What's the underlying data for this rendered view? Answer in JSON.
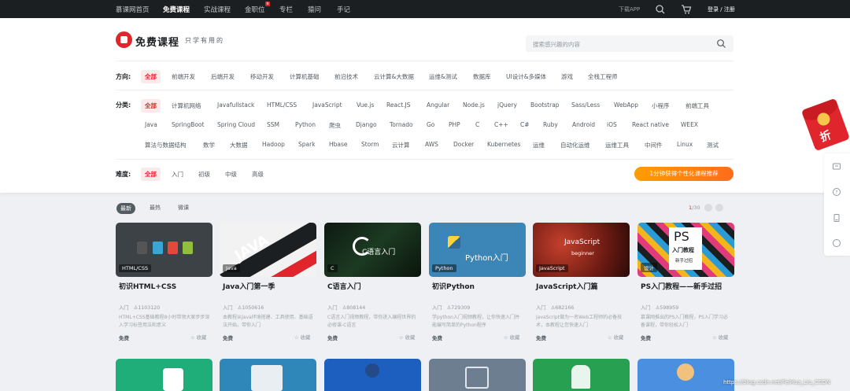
{
  "topnav": {
    "items": [
      "慕课网首页",
      "免费课程",
      "实战课程",
      "金职位",
      "专栏",
      "猿问",
      "手记"
    ],
    "badge": "N",
    "app": "下载APP",
    "login": "登录 / 注册"
  },
  "header": {
    "title": "免费课程",
    "subtitle": "只学有用的",
    "search_placeholder": "搜索感兴趣的内容"
  },
  "filters": {
    "direction_label": "方向:",
    "direction": [
      "全部",
      "前端开发",
      "后端开发",
      "移动开发",
      "计算机基础",
      "前沿技术",
      "云计算&大数据",
      "运维&测试",
      "数据库",
      "UI设计&多媒体",
      "游戏",
      "全栈工程师"
    ],
    "category_label": "分类:",
    "category_row1": [
      "全部",
      "计算机网络",
      "Javafullstack",
      "HTML/CSS",
      "JavaScript",
      "Vue.js",
      "React.JS",
      "Angular",
      "Node.js",
      "jQuery",
      "Bootstrap",
      "Sass/Less",
      "WebApp",
      "小程序",
      "前端工具"
    ],
    "category_row2": [
      "Java",
      "SpringBoot",
      "Spring Cloud",
      "SSM",
      "Python",
      "爬虫",
      "Django",
      "Tornado",
      "Go",
      "PHP",
      "C",
      "C++",
      "C#",
      "Ruby",
      "Android",
      "iOS",
      "React native",
      "WEEX"
    ],
    "category_row3": [
      "算法与数据结构",
      "数学",
      "大数据",
      "Hadoop",
      "Spark",
      "Hbase",
      "Storm",
      "云计算",
      "AWS",
      "Docker",
      "Kubernetes",
      "运维",
      "自动化运维",
      "运维工具",
      "中间件",
      "Linux",
      "测试"
    ],
    "difficulty_label": "难度:",
    "difficulty": [
      "全部",
      "入门",
      "初级",
      "中级",
      "高级"
    ],
    "recommend": "1分钟获得个性化课程推荐"
  },
  "sort": {
    "options": [
      "最新",
      "最热",
      "微课"
    ],
    "page_current": "1",
    "page_total": "/30"
  },
  "courses": [
    {
      "category": "HTML/CSS",
      "title": "初识HTML+CSS",
      "level": "入门",
      "learners": "1103120",
      "desc": "HTML+CSS基础教程8小时带领大家步步深入学习标签用法和意义",
      "price": "免费",
      "fav": "收藏",
      "art": ""
    },
    {
      "category": "Java",
      "title": "Java入门第一季",
      "level": "入门",
      "learners": "1050616",
      "desc": "本教程从Java环境搭建、工具使用、基础语法开始，带你入门",
      "price": "免费",
      "fav": "收藏",
      "art": "JAVA"
    },
    {
      "category": "C",
      "title": "C语言入门",
      "level": "入门",
      "learners": "808144",
      "desc": "C语言入门视频教程，带你进入编程世界的必修课-C语言",
      "price": "免费",
      "fav": "收藏",
      "art": "C语言入门"
    },
    {
      "category": "Python",
      "title": "初识Python",
      "level": "入门",
      "learners": "729309",
      "desc": "学python入门视频教程，让你快速入门并能编写简单的Python程序",
      "price": "免费",
      "fav": "收藏",
      "art": "Python入门"
    },
    {
      "category": "JavaScript",
      "title": "JavaScript入门篇",
      "level": "入门",
      "learners": "682166",
      "desc": "JavaScript做为一名Web工程师的必备技术，本教程让您快速入门",
      "price": "免费",
      "fav": "收藏",
      "art": "JavaScript"
    },
    {
      "category": "设计",
      "title": "PS入门教程——新手过招",
      "level": "入门",
      "learners": "598959",
      "desc": "慕课网推出的PS入门教程，PS入门学习必备课程，带你轻松入门",
      "price": "免费",
      "fav": "收藏",
      "art": "PS"
    }
  ],
  "course_learner_prefix": "人",
  "course_art": {
    "c_sub": "beginner",
    "ps_sub1": "入门教程",
    "ps_sub2": "新手过招"
  },
  "watermark": "https://blog.csdn.net/FeiHua_Liu_CSDN",
  "colors": {
    "accent": "#e0262c",
    "topbar": "#1c1f21",
    "recommend": "#ff8a00"
  }
}
